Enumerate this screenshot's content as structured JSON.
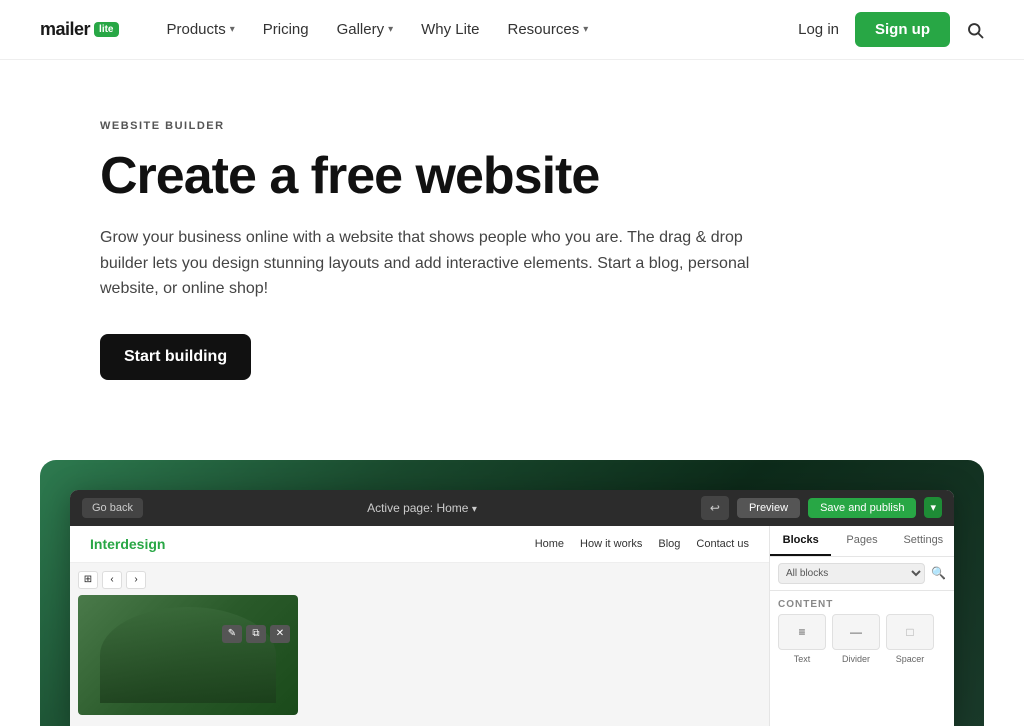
{
  "brand": {
    "name": "mailer",
    "badge": "lite"
  },
  "nav": {
    "links": [
      {
        "label": "Products",
        "hasDropdown": true
      },
      {
        "label": "Pricing",
        "hasDropdown": false
      },
      {
        "label": "Gallery",
        "hasDropdown": true
      },
      {
        "label": "Why Lite",
        "hasDropdown": false
      },
      {
        "label": "Resources",
        "hasDropdown": true
      }
    ],
    "login_label": "Log in",
    "signup_label": "Sign up"
  },
  "hero": {
    "label": "WEBSITE BUILDER",
    "title": "Create a free website",
    "description": "Grow your business online with a website that shows people who you are. The drag & drop builder lets you design stunning layouts and add interactive elements. Start a blog, personal website, or online shop!",
    "cta_label": "Start building"
  },
  "builder": {
    "back_label": "Go back",
    "active_page_label": "Active page:",
    "active_page_value": "Home",
    "preview_label": "Preview",
    "publish_label": "Save and publish",
    "site_logo": "Interdesign",
    "site_nav": [
      "Home",
      "How it works",
      "Blog",
      "Contact us"
    ],
    "sidebar_tabs": [
      "Blocks",
      "Pages",
      "Settings"
    ],
    "filter_label": "All blocks",
    "content_label": "CONTENT",
    "blocks": [
      {
        "label": "Text",
        "icon": "≡"
      },
      {
        "label": "Divider",
        "icon": "—"
      },
      {
        "label": "Spacer",
        "icon": "⬜"
      }
    ]
  }
}
